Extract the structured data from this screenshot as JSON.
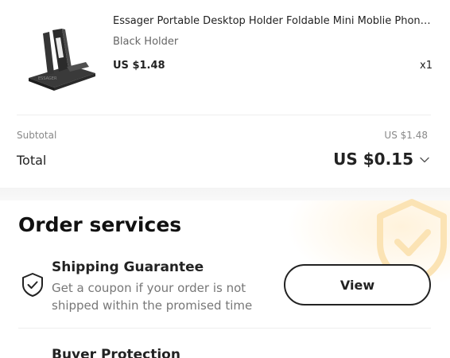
{
  "product": {
    "title": "Essager Portable Desktop Holder Foldable Mini Moblie Phone St...",
    "variant": "Black Holder",
    "price": "US $1.48",
    "quantity": "x1"
  },
  "totals": {
    "subtotal_label": "Subtotal",
    "subtotal_value": "US $1.48",
    "total_label": "Total",
    "total_value": "US $0.15"
  },
  "order_services": {
    "title": "Order services",
    "items": [
      {
        "name": "Shipping Guarantee",
        "description": "Get a coupon if your order is not shipped within the promised time",
        "button_label": "View",
        "icon": "shield-check-icon"
      },
      {
        "name": "Buyer Protection"
      }
    ]
  },
  "colors": {
    "text_primary": "#222222",
    "text_secondary": "#777777",
    "divider": "#eeeeee",
    "watermark": "#fbe3b4"
  }
}
